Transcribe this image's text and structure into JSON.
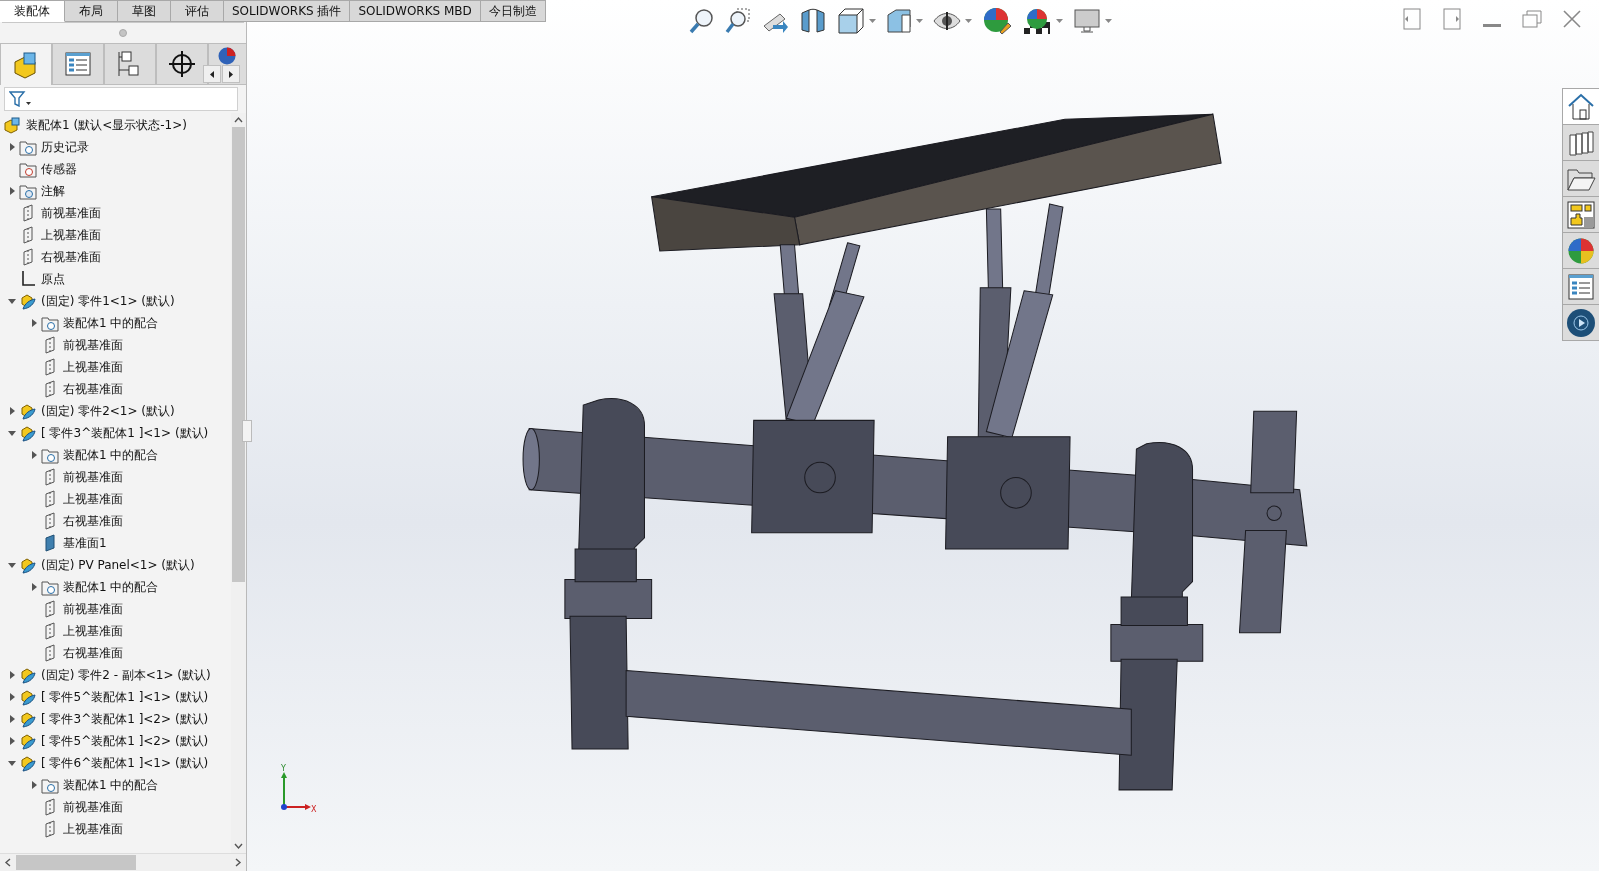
{
  "tabs": [
    {
      "label": "装配体",
      "selected": true
    },
    {
      "label": "布局",
      "selected": false
    },
    {
      "label": "草图",
      "selected": false
    },
    {
      "label": "评估",
      "selected": false
    },
    {
      "label": "SOLIDWORKS 插件",
      "selected": false
    },
    {
      "label": "SOLIDWORKS MBD",
      "selected": false
    },
    {
      "label": "今日制造",
      "selected": false
    }
  ],
  "panel_tabs": [
    {
      "kind": "feature-tree",
      "selected": true
    },
    {
      "kind": "property",
      "selected": false
    },
    {
      "kind": "config",
      "selected": false
    },
    {
      "kind": "dimxpert",
      "selected": false
    },
    {
      "kind": "display",
      "selected": false
    }
  ],
  "tree": {
    "label": "装配体1 (默认<显示状态-1>)",
    "kind": "assembly",
    "children": [
      {
        "label": "历史记录",
        "kind": "history",
        "expanded": false
      },
      {
        "label": "传感器",
        "kind": "sensor"
      },
      {
        "label": "注解",
        "kind": "annotation",
        "expanded": false
      },
      {
        "label": "前视基准面",
        "kind": "plane"
      },
      {
        "label": "上视基准面",
        "kind": "plane"
      },
      {
        "label": "右视基准面",
        "kind": "plane"
      },
      {
        "label": "原点",
        "kind": "origin"
      },
      {
        "label": "(固定) 零件1<1> (默认)",
        "kind": "part",
        "expanded": true,
        "children": [
          {
            "label": "装配体1 中的配合",
            "kind": "mates",
            "expanded": false
          },
          {
            "label": "前视基准面",
            "kind": "plane"
          },
          {
            "label": "上视基准面",
            "kind": "plane"
          },
          {
            "label": "右视基准面",
            "kind": "plane"
          }
        ]
      },
      {
        "label": "(固定) 零件2<1> (默认)",
        "kind": "part",
        "expanded": false
      },
      {
        "label": "[ 零件3^装配体1 ]<1> (默认)",
        "kind": "part",
        "expanded": true,
        "children": [
          {
            "label": "装配体1 中的配合",
            "kind": "mates",
            "expanded": false
          },
          {
            "label": "前视基准面",
            "kind": "plane"
          },
          {
            "label": "上视基准面",
            "kind": "plane"
          },
          {
            "label": "右视基准面",
            "kind": "plane"
          },
          {
            "label": "基准面1",
            "kind": "plane-solid"
          }
        ]
      },
      {
        "label": "(固定) PV Panel<1> (默认)",
        "kind": "part",
        "expanded": true,
        "children": [
          {
            "label": "装配体1 中的配合",
            "kind": "mates",
            "expanded": false
          },
          {
            "label": "前视基准面",
            "kind": "plane"
          },
          {
            "label": "上视基准面",
            "kind": "plane"
          },
          {
            "label": "右视基准面",
            "kind": "plane"
          }
        ]
      },
      {
        "label": "(固定) 零件2 - 副本<1> (默认)",
        "kind": "part",
        "expanded": false
      },
      {
        "label": "[ 零件5^装配体1 ]<1> (默认)",
        "kind": "part",
        "expanded": false
      },
      {
        "label": "[ 零件3^装配体1 ]<2> (默认)",
        "kind": "part",
        "expanded": false
      },
      {
        "label": "[ 零件5^装配体1 ]<2> (默认)",
        "kind": "part",
        "expanded": false
      },
      {
        "label": "[ 零件6^装配体1 ]<1> (默认)",
        "kind": "part",
        "expanded": true,
        "children": [
          {
            "label": "装配体1 中的配合",
            "kind": "mates",
            "expanded": false
          },
          {
            "label": "前视基准面",
            "kind": "plane"
          },
          {
            "label": "上视基准面",
            "kind": "plane"
          }
        ]
      }
    ]
  },
  "task_pane": [
    {
      "kind": "home",
      "selected": true
    },
    {
      "kind": "library",
      "selected": false
    },
    {
      "kind": "explorer",
      "selected": false
    },
    {
      "kind": "palette",
      "selected": false
    },
    {
      "kind": "appearance",
      "selected": false
    },
    {
      "kind": "properties",
      "selected": false
    },
    {
      "kind": "player",
      "selected": false
    }
  ],
  "triad": {
    "y_label": "Y",
    "x_label": "X"
  }
}
